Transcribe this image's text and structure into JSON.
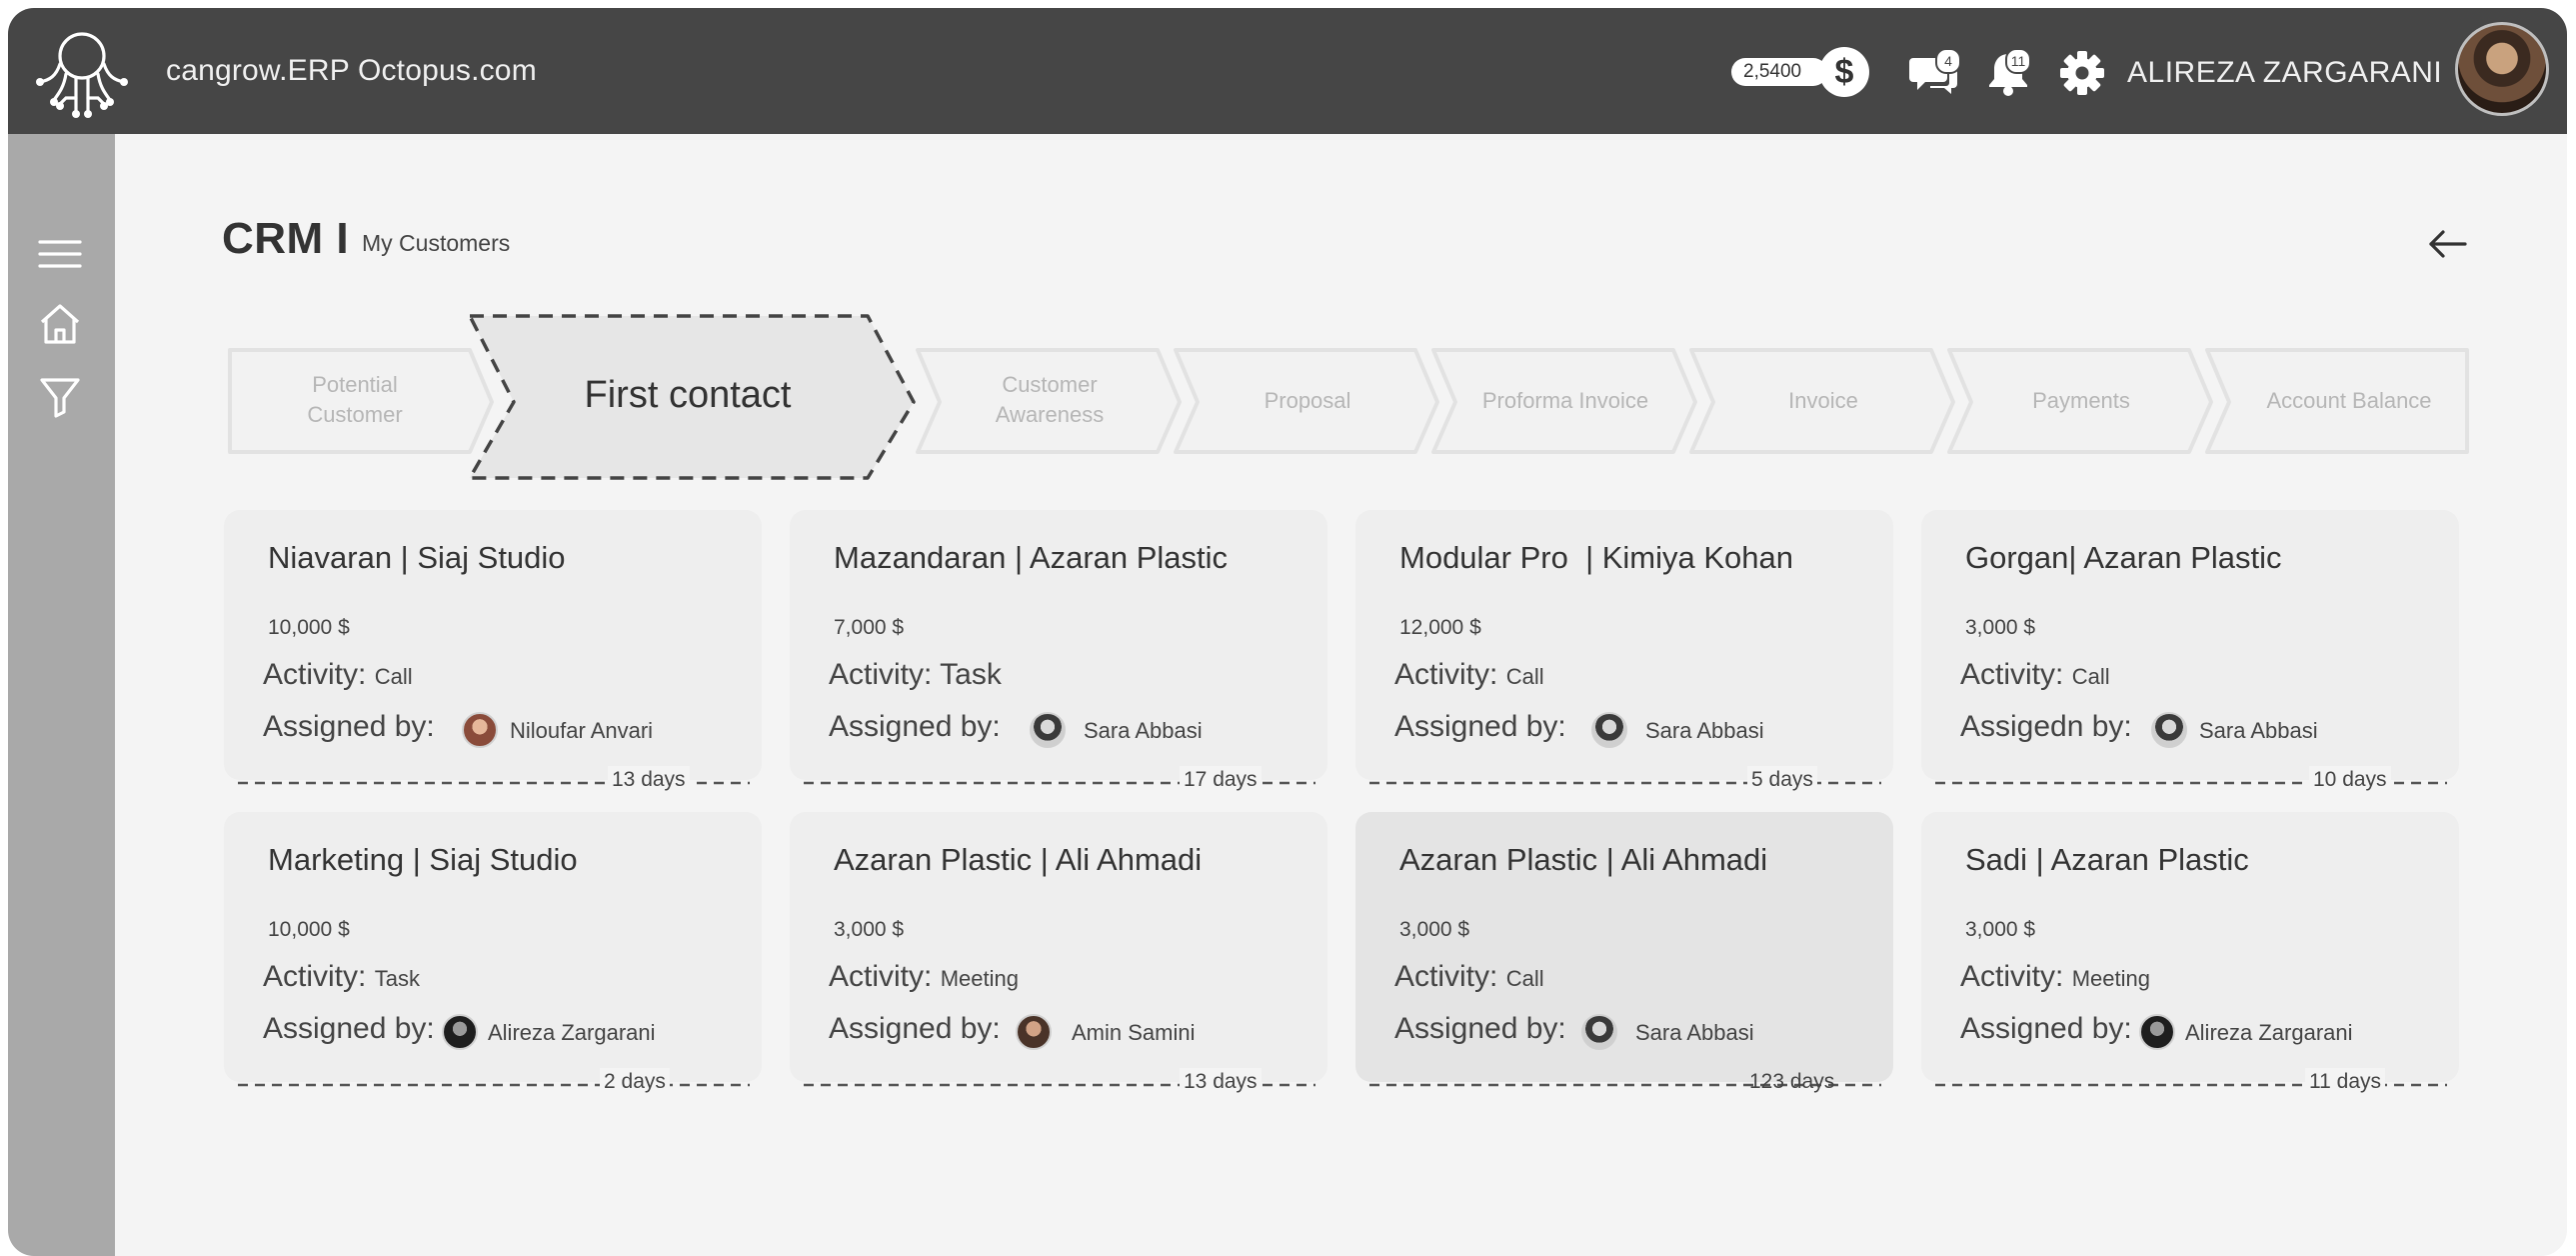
{
  "header": {
    "app_title": "cangrow.ERP Octopus.com",
    "coins": "2,5400",
    "coin_symbol": "$",
    "messages_badge": "4",
    "notifications_badge": "11",
    "username": "ALIREZA ZARGARANI"
  },
  "page": {
    "title": "CRM I",
    "subtitle": "My Customers"
  },
  "stages": [
    {
      "label": "Potential\nCustomer",
      "active": false
    },
    {
      "label": "First contact",
      "active": true
    },
    {
      "label": "Customer\nAwareness",
      "active": false
    },
    {
      "label": "Proposal",
      "active": false
    },
    {
      "label": "Proforma Invoice",
      "active": false
    },
    {
      "label": "Invoice",
      "active": false
    },
    {
      "label": "Payments",
      "active": false
    },
    {
      "label": "Account Balance",
      "active": false
    }
  ],
  "labels": {
    "activity": "Activity:",
    "assigned_by": "Assigned by:"
  },
  "cards": [
    {
      "title": "Niavaran | Siaj Studio",
      "amount": "10,000 $",
      "activity_label": "Activity:",
      "activity": "Call",
      "assigned_label": "Assigned by:",
      "person": "Niloufar Anvari",
      "days": "13 days"
    },
    {
      "title": "Mazandaran | Azaran Plastic",
      "amount": "7,000 $",
      "activity_label": "Activity:",
      "activity": "Task",
      "assigned_label": "Assigned by:",
      "person": "Sara Abbasi",
      "days": "17 days"
    },
    {
      "title": "Modular Pro  | Kimiya Kohan",
      "amount": "12,000 $",
      "activity_label": "Activity:",
      "activity": "Call",
      "assigned_label": "Assigned by:",
      "person": "Sara Abbasi",
      "days": "5 days"
    },
    {
      "title": "Gorgan| Azaran Plastic",
      "amount": "3,000 $",
      "activity_label": "Activity:",
      "activity": "Call",
      "assigned_label": "Assigedn by:",
      "person": "Sara Abbasi",
      "days": "10 days"
    },
    {
      "title": "Marketing | Siaj Studio",
      "amount": "10,000 $",
      "activity_label": "Activity:",
      "activity": "Task",
      "assigned_label": "Assigned by:",
      "person": "Alireza Zargarani",
      "days": "2 days"
    },
    {
      "title": "Azaran Plastic | Ali Ahmadi",
      "amount": "3,000 $",
      "activity_label": "Activity:",
      "activity": "Meeting",
      "assigned_label": "Assigned by:",
      "person": "Amin Samini",
      "days": "13 days"
    },
    {
      "title": "Azaran Plastic | Ali Ahmadi",
      "amount": "3,000 $",
      "activity_label": "Activity:",
      "activity": "Call",
      "assigned_label": "Assigned by:",
      "person": "Sara Abbasi",
      "days": "123 days",
      "selected": true
    },
    {
      "title": "Sadi | Azaran Plastic",
      "amount": "3,000 $",
      "activity_label": "Activity:",
      "activity": "Meeting",
      "assigned_label": "Assigned by:",
      "person": "Alireza Zargarani",
      "days": "11 days"
    }
  ],
  "icons": {
    "logo": "octopus-logo-icon",
    "coin": "dollar-coin-icon",
    "messages": "chat-bubbles-icon",
    "notifications": "bell-icon",
    "settings": "gear-icon",
    "menu": "hamburger-menu-icon",
    "home": "home-icon",
    "filter": "filter-icon",
    "back": "arrow-left-icon"
  },
  "colors": {
    "topbar": "#464646",
    "sidebar": "#a9a9a9",
    "page_bg": "#f4f4f4",
    "card_bg": "#eeeeee",
    "card_selected_bg": "#e4e4e4"
  }
}
